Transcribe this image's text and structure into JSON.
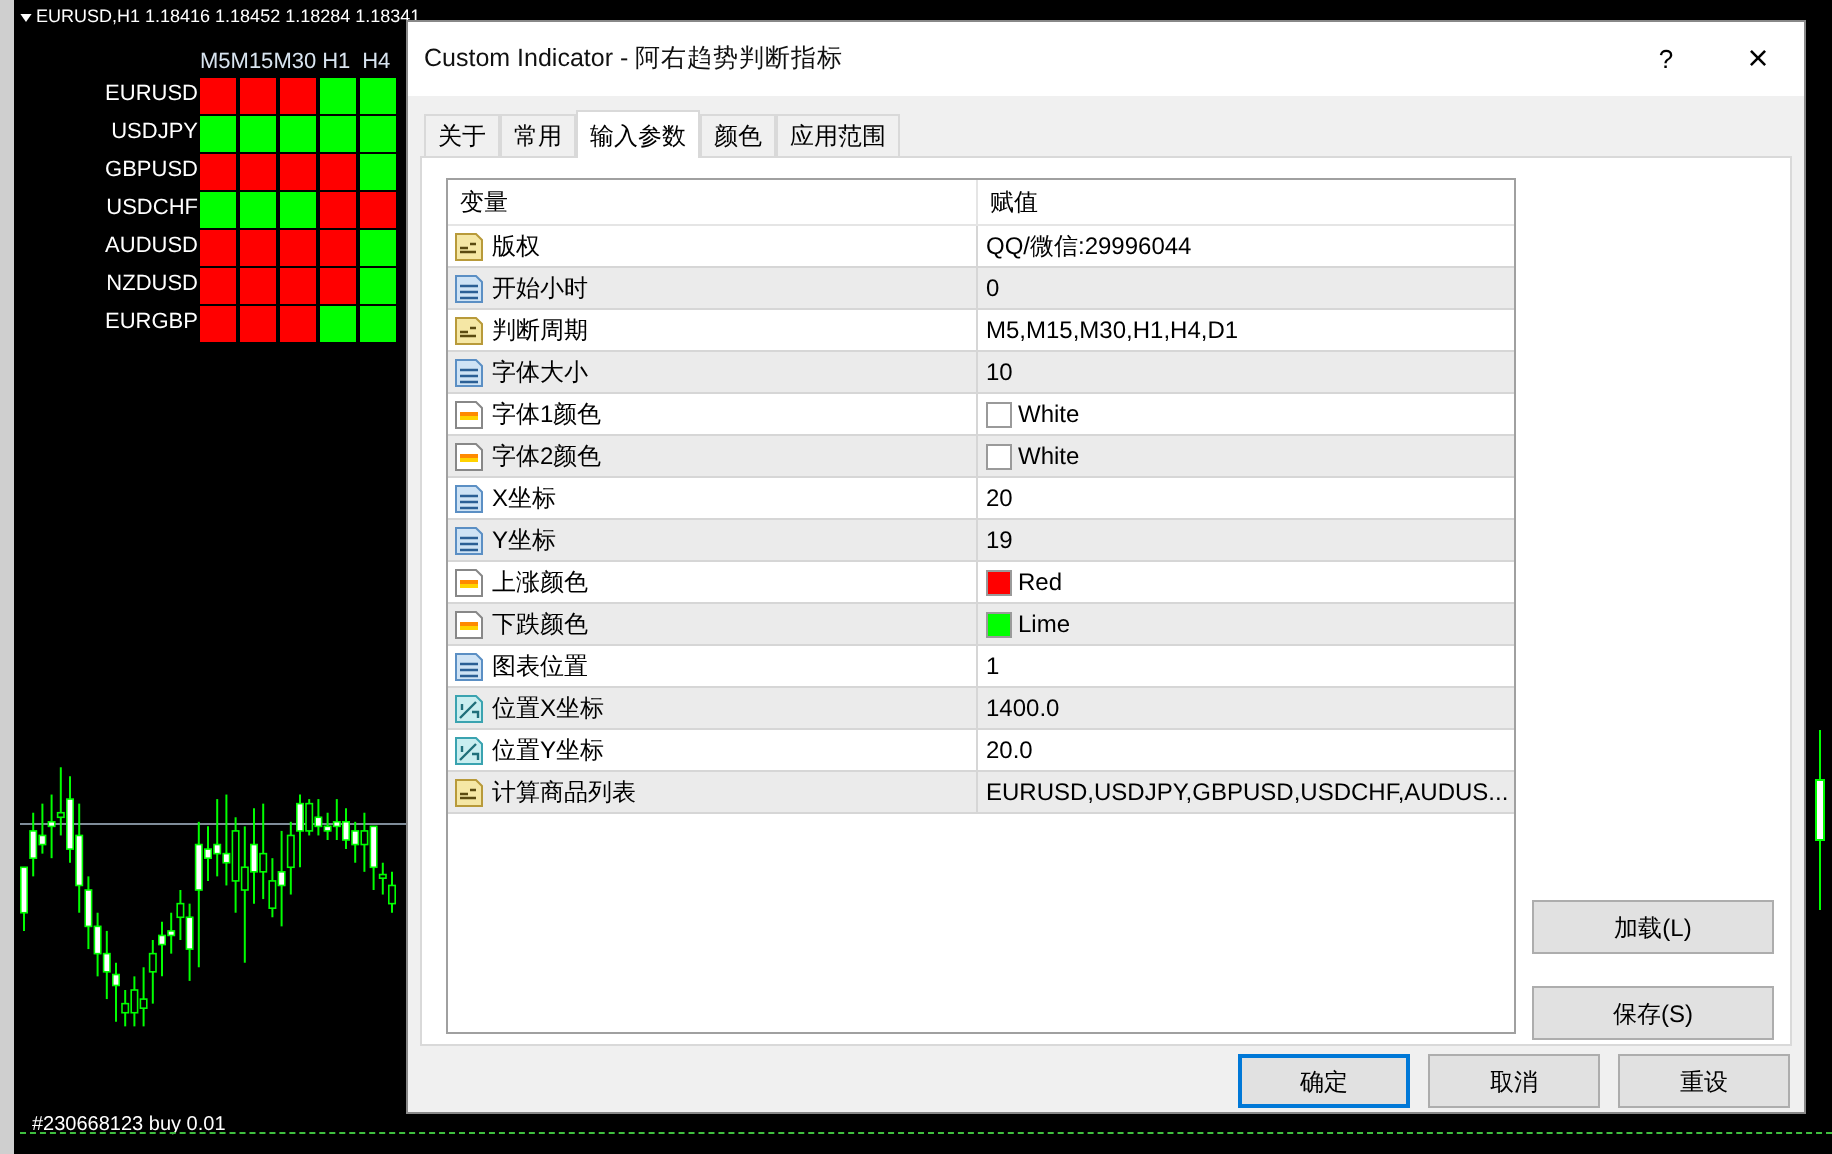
{
  "chart_window": {
    "title": "EURUSD,H1 1.18416 1.18452 1.18284 1.18341",
    "order_label": "#230668123 buy 0.01"
  },
  "trend_matrix": {
    "columns": [
      "M5",
      "M15",
      "M30",
      "H1",
      "H4"
    ],
    "rows": [
      {
        "symbol": "EURUSD",
        "cells": [
          {
            "color": "#ff0000"
          },
          {
            "color": "#ff0000"
          },
          {
            "color": "#ff0000"
          },
          {
            "color": "#00ff00"
          },
          {
            "color": "#00ff00"
          }
        ]
      },
      {
        "symbol": "USDJPY",
        "cells": [
          {
            "color": "#00ff00"
          },
          {
            "color": "#00ff00"
          },
          {
            "color": "#00ff00"
          },
          {
            "color": "#00ff00"
          },
          {
            "color": "#00ff00"
          }
        ]
      },
      {
        "symbol": "GBPUSD",
        "cells": [
          {
            "color": "#ff0000"
          },
          {
            "color": "#ff0000"
          },
          {
            "color": "#ff0000"
          },
          {
            "color": "#ff0000"
          },
          {
            "color": "#00ff00"
          }
        ]
      },
      {
        "symbol": "USDCHF",
        "cells": [
          {
            "color": "#00ff00"
          },
          {
            "color": "#00ff00"
          },
          {
            "color": "#00ff00"
          },
          {
            "color": "#ff0000"
          },
          {
            "color": "#ff0000"
          }
        ]
      },
      {
        "symbol": "AUDUSD",
        "cells": [
          {
            "color": "#ff0000"
          },
          {
            "color": "#ff0000"
          },
          {
            "color": "#ff0000"
          },
          {
            "color": "#ff0000"
          },
          {
            "color": "#00ff00"
          }
        ]
      },
      {
        "symbol": "NZDUSD",
        "cells": [
          {
            "color": "#ff0000"
          },
          {
            "color": "#ff0000"
          },
          {
            "color": "#ff0000"
          },
          {
            "color": "#ff0000"
          },
          {
            "color": "#00ff00"
          }
        ]
      },
      {
        "symbol": "EURGBP",
        "cells": [
          {
            "color": "#ff0000"
          },
          {
            "color": "#ff0000"
          },
          {
            "color": "#ff0000"
          },
          {
            "color": "#00ff00"
          },
          {
            "color": "#00ff00"
          }
        ]
      }
    ]
  },
  "dialog": {
    "title": "Custom Indicator - 阿右趋势判断指标",
    "help": "?",
    "close": "×",
    "tabs": [
      {
        "label": "关于",
        "selected": false
      },
      {
        "label": "常用",
        "selected": false
      },
      {
        "label": "输入参数",
        "selected": true
      },
      {
        "label": "颜色",
        "selected": false
      },
      {
        "label": "应用范围",
        "selected": false
      }
    ],
    "table": {
      "columns": [
        "变量",
        "赋值"
      ],
      "rows": [
        {
          "kind": "string",
          "name": "版权",
          "value": "QQ/微信:29996044"
        },
        {
          "kind": "int",
          "name": "开始小时",
          "value": "0"
        },
        {
          "kind": "string",
          "name": "判断周期",
          "value": "M5,M15,M30,H1,H4,D1"
        },
        {
          "kind": "int",
          "name": "字体大小",
          "value": "10"
        },
        {
          "kind": "color",
          "name": "字体1颜色",
          "value": "White",
          "color": "#ffffff"
        },
        {
          "kind": "color",
          "name": "字体2颜色",
          "value": "White",
          "color": "#ffffff"
        },
        {
          "kind": "int",
          "name": "X坐标",
          "value": "20"
        },
        {
          "kind": "int",
          "name": "Y坐标",
          "value": "19"
        },
        {
          "kind": "color",
          "name": "上涨颜色",
          "value": "Red",
          "color": "#ff0000"
        },
        {
          "kind": "color",
          "name": "下跌颜色",
          "value": "Lime",
          "color": "#00ff00"
        },
        {
          "kind": "int",
          "name": "图表位置",
          "value": "1"
        },
        {
          "kind": "double",
          "name": "位置X坐标",
          "value": "1400.0"
        },
        {
          "kind": "double",
          "name": "位置Y坐标",
          "value": "20.0"
        },
        {
          "kind": "string",
          "name": "计算商品列表",
          "value": "EURUSD,USDJPY,GBPUSD,USDCHF,AUDUS..."
        }
      ]
    },
    "side_buttons": [
      "加载(L)",
      "保存(S)"
    ],
    "buttons": [
      {
        "label": "确定",
        "selected": true
      },
      {
        "label": "取消",
        "selected": false
      },
      {
        "label": "重设",
        "selected": false
      }
    ]
  }
}
